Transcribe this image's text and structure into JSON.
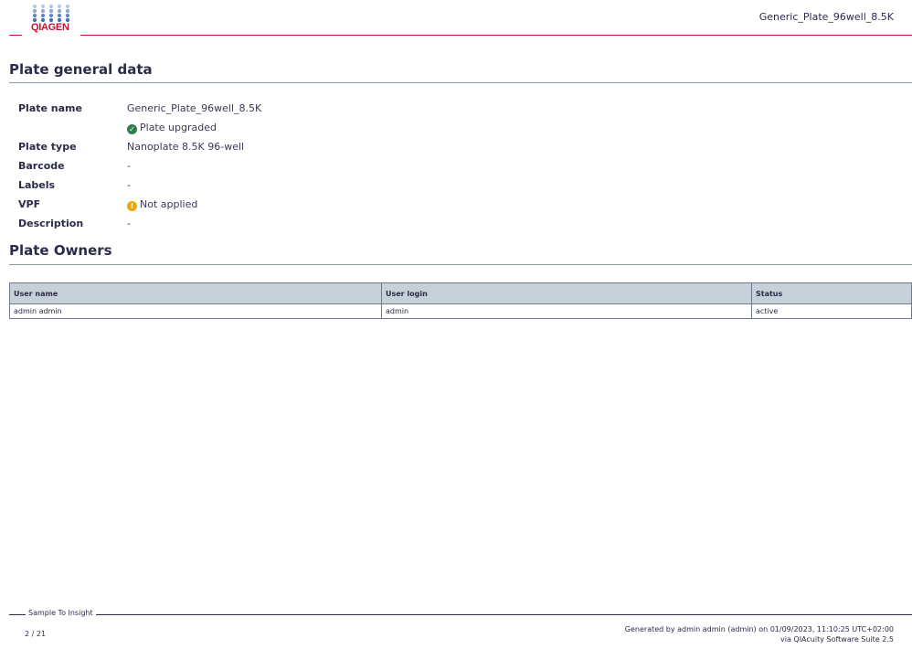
{
  "brand": {
    "logo_text": "QIAGEN",
    "accent": "#c8102e",
    "dot_color": "#3d6fb5"
  },
  "header": {
    "doc_title": "Generic_Plate_96well_8.5K"
  },
  "general": {
    "title": "Plate general data",
    "rows": [
      {
        "label": "Plate name",
        "value": "Generic_Plate_96well_8.5K"
      },
      {
        "label": "",
        "value": "Plate upgraded",
        "icon": "check-circle-icon",
        "icon_color": "#2e7d4f"
      },
      {
        "label": "Plate type",
        "value": "Nanoplate 8.5K 96-well"
      },
      {
        "label": "Barcode",
        "value": "-"
      },
      {
        "label": "Labels",
        "value": "-"
      },
      {
        "label": "VPF",
        "value": "Not applied",
        "icon": "warning-circle-icon",
        "icon_color": "#f0a500"
      },
      {
        "label": "Description",
        "value": "-"
      }
    ]
  },
  "owners": {
    "title": "Plate Owners",
    "columns": [
      "User name",
      "User login",
      "Status"
    ],
    "rows": [
      [
        "admin admin",
        "admin",
        "active"
      ]
    ]
  },
  "footer": {
    "tagline": "Sample To Insight",
    "page": "2 / 21",
    "generated_line1": "Generated by admin admin (admin) on 01/09/2023, 11:10:25 UTC+02:00",
    "generated_line2": "via QIAcuity Software Suite 2.5"
  }
}
